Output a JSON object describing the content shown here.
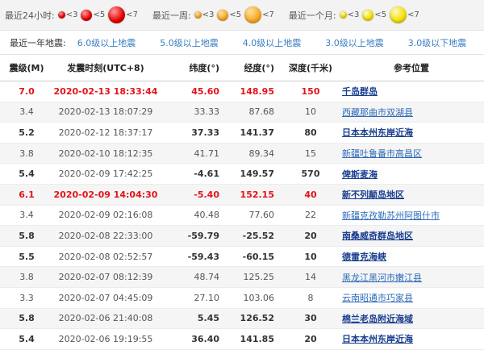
{
  "legend": [
    {
      "title": "最近24小时:",
      "color": "red",
      "items": [
        {
          "label": "<3",
          "size": 9
        },
        {
          "label": "<5",
          "size": 14
        },
        {
          "label": "<7",
          "size": 21
        }
      ]
    },
    {
      "title": "最近一周:",
      "color": "orange",
      "items": [
        {
          "label": "<3",
          "size": 9
        },
        {
          "label": "<5",
          "size": 14
        },
        {
          "label": "<7",
          "size": 21
        }
      ]
    },
    {
      "title": "最近一个月:",
      "color": "yellow",
      "items": [
        {
          "label": "<3",
          "size": 9
        },
        {
          "label": "<5",
          "size": 14
        },
        {
          "label": "<7",
          "size": 21
        }
      ]
    }
  ],
  "filter": {
    "title": "最近一年地震:",
    "links": [
      "6.0级以上地震",
      "5.0级以上地震",
      "4.0级以上地震",
      "3.0级以上地震",
      "3.0级以下地震"
    ]
  },
  "table": {
    "headers": [
      "震级(M)",
      "发震时刻(UTC+8)",
      "纬度(°)",
      "经度(°)",
      "深度(千米)",
      "参考位置"
    ],
    "rows": [
      {
        "mag": "7.0",
        "time": "2020-02-13 18:33:44",
        "lat": "45.60",
        "lon": "148.95",
        "depth": "150",
        "loc": "千岛群岛",
        "level": "big"
      },
      {
        "mag": "3.4",
        "time": "2020-02-13 18:07:29",
        "lat": "33.33",
        "lon": "87.68",
        "depth": "10",
        "loc": "西藏那曲市双湖县",
        "level": "normal"
      },
      {
        "mag": "5.2",
        "time": "2020-02-12 18:37:17",
        "lat": "37.33",
        "lon": "141.37",
        "depth": "80",
        "loc": "日本本州东岸近海",
        "level": "bold"
      },
      {
        "mag": "3.8",
        "time": "2020-02-10 18:12:35",
        "lat": "41.71",
        "lon": "89.34",
        "depth": "15",
        "loc": "新疆吐鲁番市高昌区",
        "level": "normal"
      },
      {
        "mag": "5.4",
        "time": "2020-02-09 17:42:25",
        "lat": "-4.61",
        "lon": "149.57",
        "depth": "570",
        "loc": "俾斯麦海",
        "level": "bold"
      },
      {
        "mag": "6.1",
        "time": "2020-02-09 14:04:30",
        "lat": "-5.40",
        "lon": "152.15",
        "depth": "40",
        "loc": "新不列颠岛地区",
        "level": "big"
      },
      {
        "mag": "3.4",
        "time": "2020-02-09 02:16:08",
        "lat": "40.48",
        "lon": "77.60",
        "depth": "22",
        "loc": "新疆克孜勒苏州阿图什市",
        "level": "normal"
      },
      {
        "mag": "5.8",
        "time": "2020-02-08 22:33:00",
        "lat": "-59.79",
        "lon": "-25.52",
        "depth": "20",
        "loc": "南桑威奇群岛地区",
        "level": "bold"
      },
      {
        "mag": "5.5",
        "time": "2020-02-08 02:52:57",
        "lat": "-59.43",
        "lon": "-60.15",
        "depth": "10",
        "loc": "德雷克海峡",
        "level": "bold"
      },
      {
        "mag": "3.8",
        "time": "2020-02-07 08:12:39",
        "lat": "48.74",
        "lon": "125.25",
        "depth": "14",
        "loc": "黑龙江黑河市嫩江县",
        "level": "normal"
      },
      {
        "mag": "3.3",
        "time": "2020-02-07 04:45:09",
        "lat": "27.10",
        "lon": "103.06",
        "depth": "8",
        "loc": "云南昭通市巧家县",
        "level": "normal"
      },
      {
        "mag": "5.8",
        "time": "2020-02-06 21:40:08",
        "lat": "5.45",
        "lon": "126.52",
        "depth": "30",
        "loc": "棉兰老岛附近海域",
        "level": "bold"
      },
      {
        "mag": "5.4",
        "time": "2020-02-06 19:19:55",
        "lat": "36.40",
        "lon": "141.85",
        "depth": "20",
        "loc": "日本本州东岸近海",
        "level": "bold"
      }
    ]
  }
}
